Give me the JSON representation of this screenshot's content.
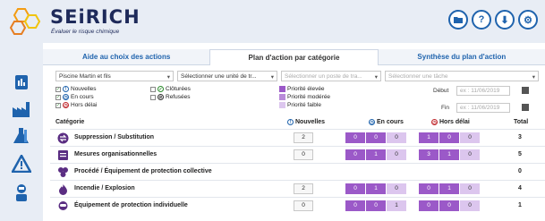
{
  "header": {
    "app_name": "SEiRICH",
    "tagline": "Évaluer le risque chimique",
    "buttons": [
      {
        "icon": "folder-open-icon"
      },
      {
        "icon": "help-icon",
        "glyph": "?"
      },
      {
        "icon": "download-icon",
        "glyph": "⬇"
      },
      {
        "icon": "settings-icon",
        "glyph": "⚙"
      }
    ]
  },
  "sidebar": {
    "items": [
      {
        "icon": "report-icon"
      },
      {
        "icon": "factory-icon"
      },
      {
        "icon": "lab-flask-icon"
      },
      {
        "icon": "warning-triangle-icon"
      },
      {
        "icon": "worker-icon"
      }
    ]
  },
  "tabs": [
    {
      "label": "Aide au choix des actions",
      "active": false
    },
    {
      "label": "Plan d'action par catégorie",
      "active": true
    },
    {
      "label": "Synthèse du plan d'action",
      "active": false
    }
  ],
  "filters": {
    "company": "Piscine Martin et fils",
    "work_unit": "Sélectionner une unité de tr...",
    "workstation": "Sélectionner un poste de tra...",
    "task": "Sélectionner une tâche"
  },
  "status_legend": {
    "nouvelles": "Nouvelles",
    "en_cours": "En cours",
    "hors_delai": "Hors délai",
    "cloturees": "Clôturées",
    "refusees": "Refusées"
  },
  "priority_legend": {
    "high": "Priorité élevée",
    "medium": "Priorité modérée",
    "low": "Priorité faible"
  },
  "dates": {
    "debut_label": "Début",
    "fin_label": "Fin",
    "debut_placeholder": "ex : 11/06/2019",
    "fin_placeholder": "ex : 11/06/2019"
  },
  "table": {
    "headers": {
      "category": "Catégorie",
      "nouvelles": "Nouvelles",
      "en_cours": "En cours",
      "hors_delai": "Hors délai",
      "total": "Total"
    },
    "rows": [
      {
        "label": "Suppression / Substitution",
        "icon": "substitution-icon",
        "nouvelles": "2",
        "en_cours": [
          "0",
          "0",
          "0"
        ],
        "hors_delai": [
          "1",
          "0",
          "0"
        ],
        "total": "3"
      },
      {
        "label": "Mesures organisationnelles",
        "icon": "organization-icon",
        "nouvelles": "0",
        "en_cours": [
          "0",
          "1",
          "0"
        ],
        "hors_delai": [
          "3",
          "1",
          "0"
        ],
        "total": "5"
      },
      {
        "label": "Procédé / Équipement de protection collective",
        "icon": "collective-protection-icon",
        "nouvelles": "",
        "en_cours": [],
        "hors_delai": [],
        "total": "0"
      },
      {
        "label": "Incendie / Explosion",
        "icon": "fire-icon",
        "nouvelles": "2",
        "en_cours": [
          "0",
          "1",
          "0"
        ],
        "hors_delai": [
          "0",
          "1",
          "0"
        ],
        "total": "4"
      },
      {
        "label": "Équipement de protection individuelle",
        "icon": "personal-protection-icon",
        "nouvelles": "0",
        "en_cours": [
          "0",
          "0",
          "1"
        ],
        "hors_delai": [
          "0",
          "0",
          "0"
        ],
        "total": "1"
      }
    ]
  },
  "colors": {
    "accent": "#1f63ad",
    "priority_high": "#9b59c8",
    "priority_medium": "#b98bd9",
    "priority_low": "#dcc6ee",
    "en_cours": "#1f63ad",
    "hors_delai": "#c0282d",
    "cloturees": "#2a8a2a"
  }
}
